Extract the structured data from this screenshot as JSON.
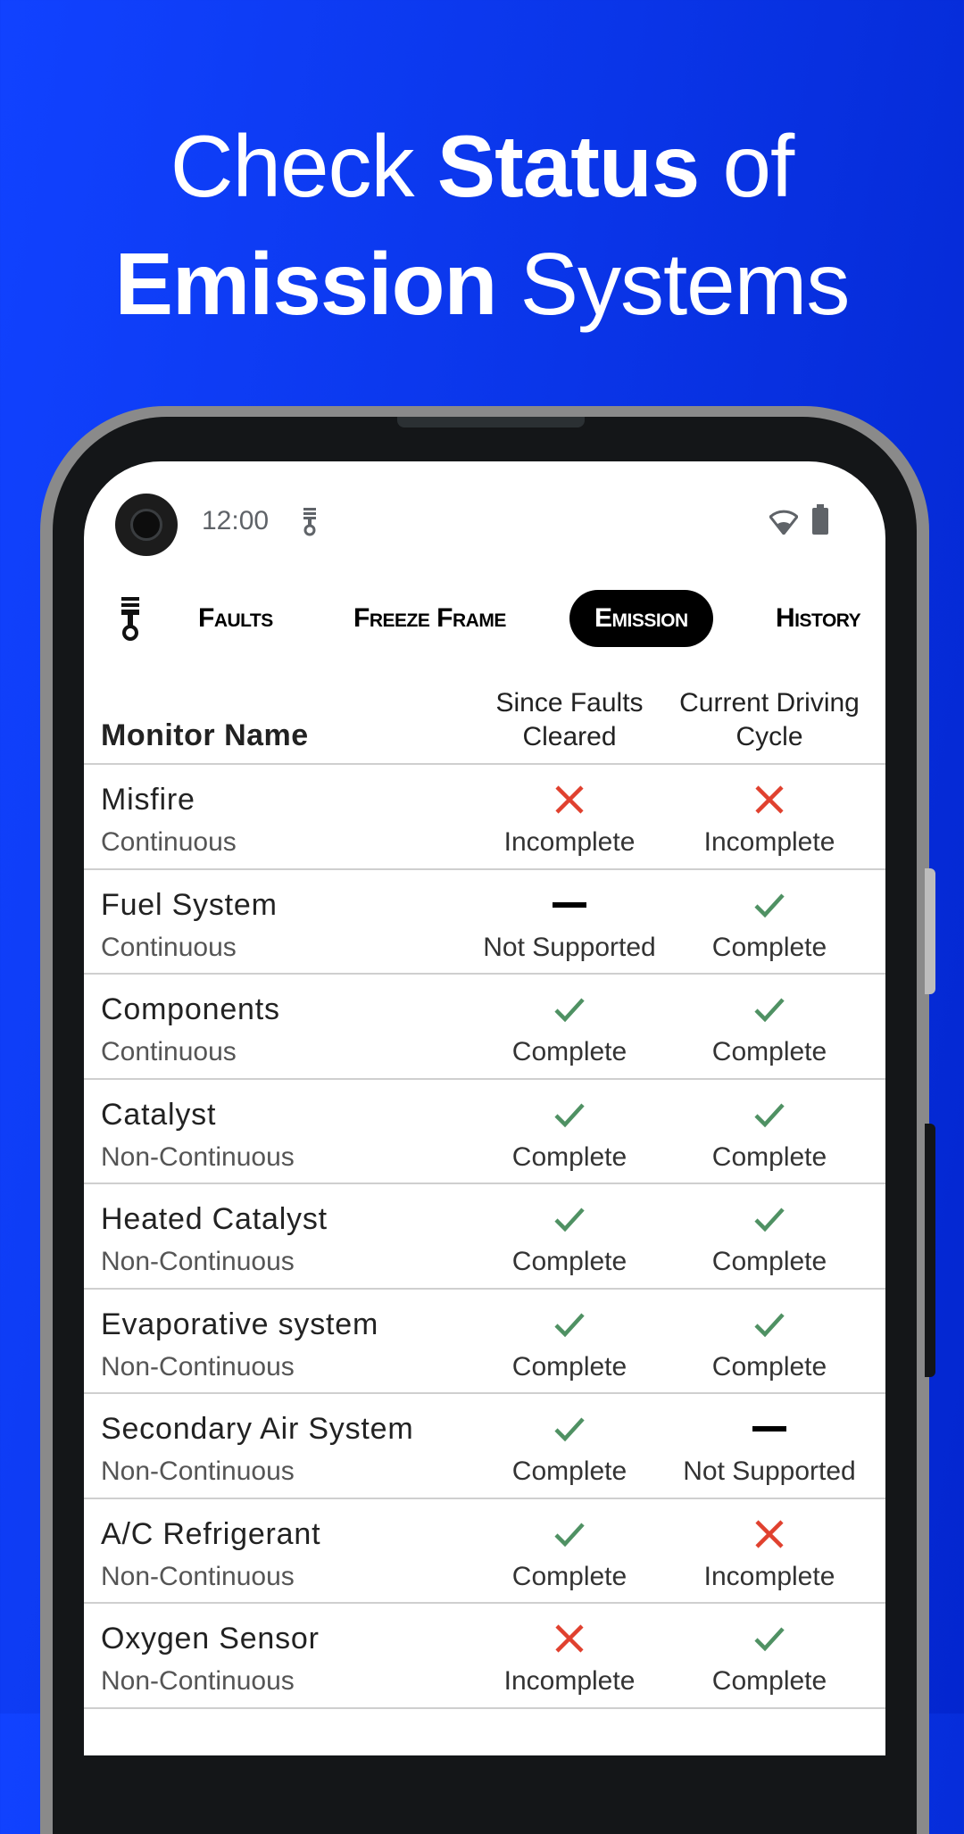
{
  "headline": {
    "line1_prefix": "Check ",
    "line1_bold": "Status",
    "line1_suffix": " of",
    "line2_bold": "Emission",
    "line2_suffix": " Systems"
  },
  "status_bar": {
    "time": "12:00",
    "icons": [
      "piston-icon",
      "wifi-icon",
      "battery-icon"
    ]
  },
  "tabs": [
    {
      "label": "Faults",
      "active": false
    },
    {
      "label": "Freeze Frame",
      "active": false
    },
    {
      "label": "Emission",
      "active": true
    },
    {
      "label": "History",
      "active": false
    }
  ],
  "table": {
    "headers": {
      "name": "Monitor Name",
      "col1": "Since Faults Cleared",
      "col2": "Current Driving Cycle"
    },
    "rows": [
      {
        "name": "Misfire",
        "type": "Continuous",
        "since": "Incomplete",
        "current": "Incomplete"
      },
      {
        "name": "Fuel System",
        "type": "Continuous",
        "since": "Not Supported",
        "current": "Complete"
      },
      {
        "name": "Components",
        "type": "Continuous",
        "since": "Complete",
        "current": "Complete"
      },
      {
        "name": "Catalyst",
        "type": "Non-Continuous",
        "since": "Complete",
        "current": "Complete"
      },
      {
        "name": "Heated Catalyst",
        "type": "Non-Continuous",
        "since": "Complete",
        "current": "Complete"
      },
      {
        "name": "Evaporative system",
        "type": "Non-Continuous",
        "since": "Complete",
        "current": "Complete"
      },
      {
        "name": "Secondary Air System",
        "type": "Non-Continuous",
        "since": "Complete",
        "current": "Not Supported"
      },
      {
        "name": "A/C Refrigerant",
        "type": "Non-Continuous",
        "since": "Complete",
        "current": "Incomplete"
      },
      {
        "name": "Oxygen Sensor",
        "type": "Non-Continuous",
        "since": "Incomplete",
        "current": "Complete"
      }
    ]
  },
  "colors": {
    "complete": "#4f9163",
    "incomplete": "#e0412f",
    "not_supported": "#000000",
    "background": "#0a35e8"
  }
}
